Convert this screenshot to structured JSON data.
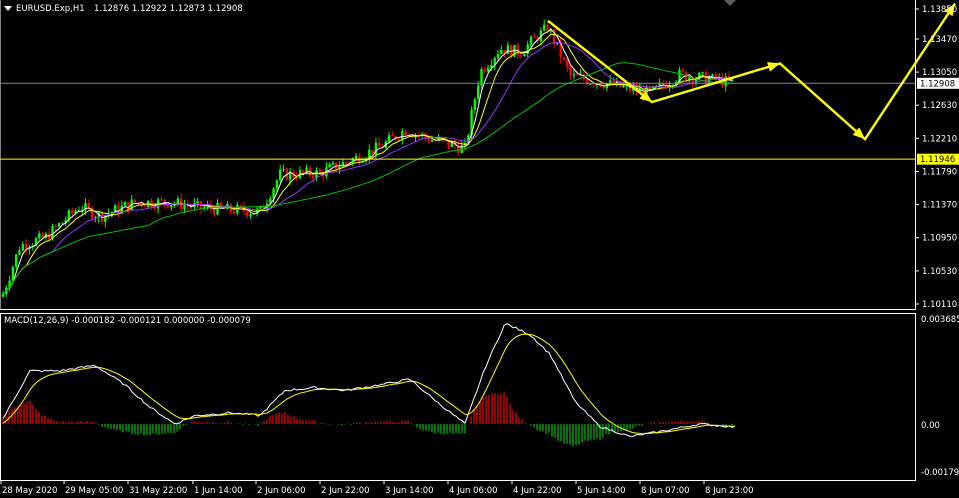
{
  "main": {
    "symbol": "EURUSD.Exp,H1",
    "ohlc": "1.12876 1.12922 1.12873 1.12908",
    "price_min": 1.1011,
    "price_max": 1.1385,
    "price_labels": [
      "1.13850",
      "1.13470",
      "1.13050",
      "1.12630",
      "1.12210",
      "1.11790",
      "1.11370",
      "1.10950",
      "1.10530",
      "1.10110"
    ],
    "current_price_label": "1.12908",
    "current_price": 1.12908,
    "level_label": "1.11946",
    "level_price": 1.11946,
    "colors": {
      "bull": "#00ff00",
      "bear": "#ff0000",
      "level": "#ffff00",
      "ma_fast": "#ffffff",
      "ma_mid": "#ffff00",
      "ma_slow_purple": "#9933ff",
      "ma_slow_green": "#00c000",
      "arrow": "#ffff00"
    }
  },
  "macd": {
    "title": "MACD(12,26,9) -0.000182 -0.000121 0.000000 -0.000079",
    "max_label": "0.003685",
    "zero_label": "0.00",
    "min_label": "-0.00179"
  },
  "time_axis": {
    "labels": [
      "28 May 2020",
      "29 May 05:00",
      "31 May 22:00",
      "1 Jun 14:00",
      "2 Jun 06:00",
      "2 Jun 22:00",
      "3 Jun 14:00",
      "4 Jun 06:00",
      "4 Jun 22:00",
      "5 Jun 14:00",
      "8 Jun 07:00",
      "8 Jun 23:00"
    ]
  },
  "forecast_arrow": {
    "prices": [
      1.137,
      1.1267,
      1.1316,
      1.122,
      1.1392
    ]
  }
}
